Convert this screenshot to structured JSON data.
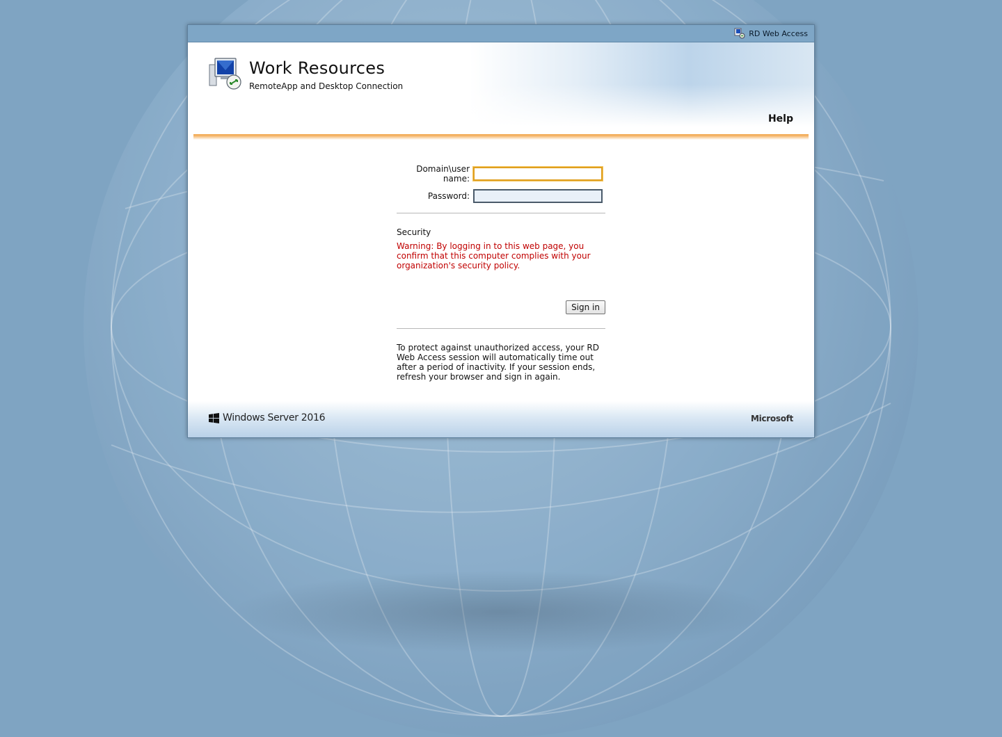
{
  "topbar": {
    "app_name": "RD Web Access",
    "app_icon": "rd-web-access-icon"
  },
  "header": {
    "title": "Work Resources",
    "subtitle": "RemoteApp and Desktop Connection",
    "help_label": "Help",
    "icon": "remoteapp-computer-icon"
  },
  "form": {
    "username_label": "Domain\\user name:",
    "username_value": "",
    "password_label": "Password:",
    "password_value": "",
    "security_label": "Security",
    "warning": "Warning: By logging in to this web page, you confirm that this computer complies with your organization's security policy.",
    "signin_label": "Sign in",
    "timeout_note": "To protect against unauthorized access, your RD Web Access session will automatically time out after a period of inactivity. If your session ends, refresh your browser and sign in again."
  },
  "footer": {
    "product": "Windows Server 2016",
    "brand": "Microsoft"
  },
  "colors": {
    "background": "#7fa4c2",
    "topbar": "#7ea6c6",
    "warning_text": "#c00000",
    "accent_orange": "#f0a040"
  }
}
